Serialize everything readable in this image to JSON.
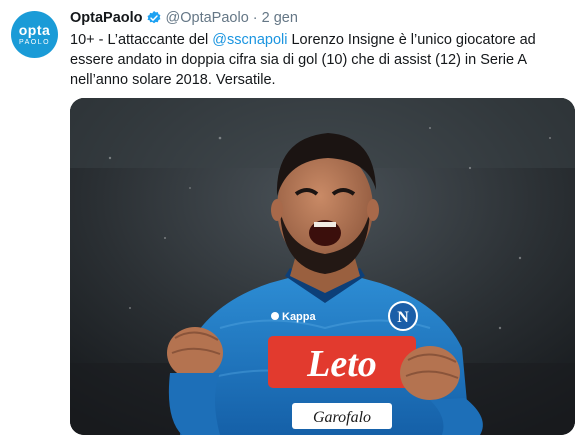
{
  "account": {
    "avatar_top": "opta",
    "avatar_bottom": "PAOLO",
    "display_name": "OptaPaolo",
    "handle": "@OptaPaolo",
    "separator": "·",
    "timestamp": "2 gen"
  },
  "tweet": {
    "text_before": "10+ - L’attaccante del ",
    "mention": "@sscnapoli",
    "text_after": " Lorenzo Insigne è l’unico giocatore ad essere andato in doppia cifra sia di gol (10) che di assist (12) in Serie A nell’anno solare 2018. Versatile."
  },
  "photo": {
    "sponsor": "Leto",
    "kit_brand": "Kappa",
    "shirt_bottom_text": "Garofalo"
  },
  "colors": {
    "brand": "#1a9bd7",
    "mention": "#1b95e0",
    "verified": "#1da1f2",
    "muted": "#657786",
    "text": "#14171a"
  }
}
